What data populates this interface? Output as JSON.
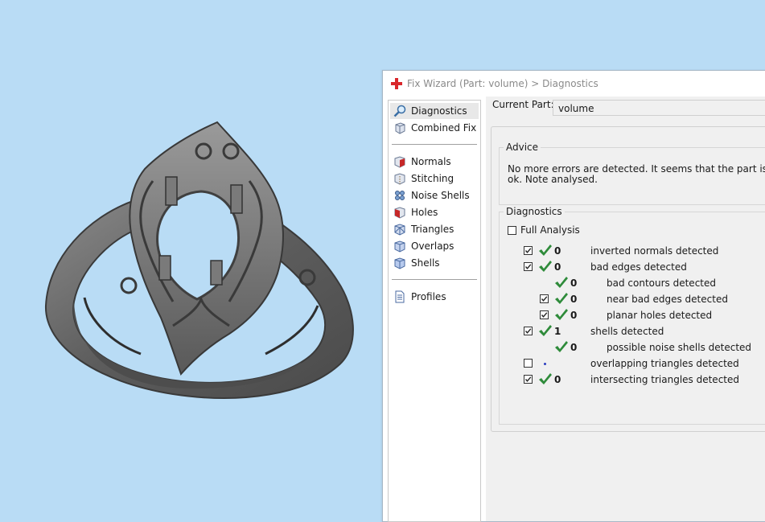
{
  "window": {
    "title": "Fix Wizard (Part: volume) > Diagnostics"
  },
  "sidebar": {
    "top_items": [
      {
        "label": "Diagnostics",
        "icon": "magnifier-icon",
        "selected": true
      },
      {
        "label": "Combined Fix",
        "icon": "cube-icon"
      }
    ],
    "tool_items": [
      {
        "label": "Normals",
        "icon": "normals-cube-icon"
      },
      {
        "label": "Stitching",
        "icon": "stitching-cube-icon"
      },
      {
        "label": "Noise Shells",
        "icon": "noise-shells-icon"
      },
      {
        "label": "Holes",
        "icon": "holes-cube-icon"
      },
      {
        "label": "Triangles",
        "icon": "triangles-cube-icon"
      },
      {
        "label": "Overlaps",
        "icon": "overlaps-cube-icon"
      },
      {
        "label": "Shells",
        "icon": "shells-cube-icon"
      }
    ],
    "bottom_items": [
      {
        "label": "Profiles",
        "icon": "document-icon"
      }
    ]
  },
  "current_part": {
    "label": "Current Part:",
    "value": "volume"
  },
  "advice": {
    "title": "Advice",
    "text": "No more errors are detected. It seems that the part is ok. Note analysed."
  },
  "diagnostics": {
    "title": "Diagnostics",
    "full_analysis_label": "Full Analysis",
    "full_analysis_checked": false,
    "rows": [
      {
        "checkbox": true,
        "checked": true,
        "status": "ok",
        "count": "0",
        "label": "inverted normals detected",
        "level": 0
      },
      {
        "checkbox": true,
        "checked": true,
        "status": "ok",
        "count": "0",
        "label": "bad edges detected",
        "level": 0
      },
      {
        "checkbox": false,
        "checked": false,
        "status": "ok",
        "count": "0",
        "label": "bad contours detected",
        "level": 1
      },
      {
        "checkbox": true,
        "checked": true,
        "status": "ok",
        "count": "0",
        "label": "near bad edges detected",
        "level": 1
      },
      {
        "checkbox": true,
        "checked": true,
        "status": "ok",
        "count": "0",
        "label": "planar holes detected",
        "level": 1
      },
      {
        "checkbox": true,
        "checked": true,
        "status": "ok",
        "count": "1",
        "label": "shells detected",
        "level": 0
      },
      {
        "checkbox": false,
        "checked": false,
        "status": "ok",
        "count": "0",
        "label": "possible noise shells detected",
        "level": 1
      },
      {
        "checkbox": true,
        "checked": false,
        "status": "pending",
        "count": "",
        "label": "overlapping triangles detected",
        "level": 0
      },
      {
        "checkbox": true,
        "checked": true,
        "status": "ok",
        "count": "0",
        "label": "intersecting triangles detected",
        "level": 0
      }
    ]
  },
  "colors": {
    "viewport_background": "#b9dcf5",
    "ok_check": "#2e8b3a",
    "title_icon": "#d9262b",
    "model": "#6c6c6c"
  }
}
